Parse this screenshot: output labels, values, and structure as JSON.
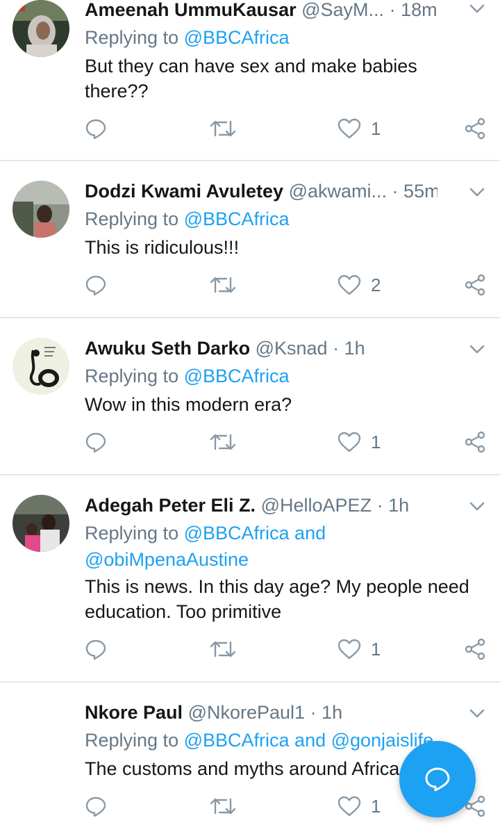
{
  "colors": {
    "accent": "#1da1f2",
    "muted": "#657786",
    "text": "#14171a",
    "divider": "#e1e8ed"
  },
  "tweets": [
    {
      "name": "Ameenah UmmuKausar",
      "handle": "@SayM...",
      "dot": "·",
      "time": "18m",
      "replying_prefix": "Replying to",
      "mentions": "@BBCAfrica",
      "text_lines": [
        "But they can have sex and make babies",
        "there??"
      ],
      "like_count": "1",
      "avatar_icon": "avatar-woman-hijab"
    },
    {
      "name": "Dodzi Kwami Avuletey",
      "handle": "@akwami...",
      "dot": "·",
      "time": "55m",
      "replying_prefix": "Replying to",
      "mentions": "@BBCAfrica",
      "text_lines": [
        "This is ridiculous!!!"
      ],
      "like_count": "2",
      "avatar_icon": "avatar-man-outdoors"
    },
    {
      "name": "Awuku Seth Darko",
      "handle": "@Ksnad",
      "dot": "·",
      "time": "1h",
      "replying_prefix": "Replying to",
      "mentions": "@BBCAfrica",
      "text_lines": [
        "Wow in this modern era?"
      ],
      "like_count": "1",
      "avatar_icon": "avatar-sketch"
    },
    {
      "name": "Adegah Peter Eli Z.",
      "handle": "@HelloAPEZ",
      "dot": "·",
      "time": "1h",
      "replying_prefix": "Replying to",
      "mentions": "@BBCAfrica and",
      "mentions_line2": "@obiMpenaAustine",
      "text_lines": [
        "This is news. In this day age? My people need",
        "education. Too primitive"
      ],
      "like_count": "1",
      "avatar_icon": "avatar-man-child"
    },
    {
      "name": "Nkore Paul",
      "handle": "@NkorePaul1",
      "dot": "·",
      "time": "1h",
      "replying_prefix": "Replying to",
      "mentions": "@BBCAfrica and @gonjaislife",
      "text_lines": [
        "The customs and myths around Africa"
      ],
      "like_count": "1",
      "avatar_icon": "avatar-none"
    }
  ],
  "fab": {
    "icon": "compose-reply-icon"
  }
}
